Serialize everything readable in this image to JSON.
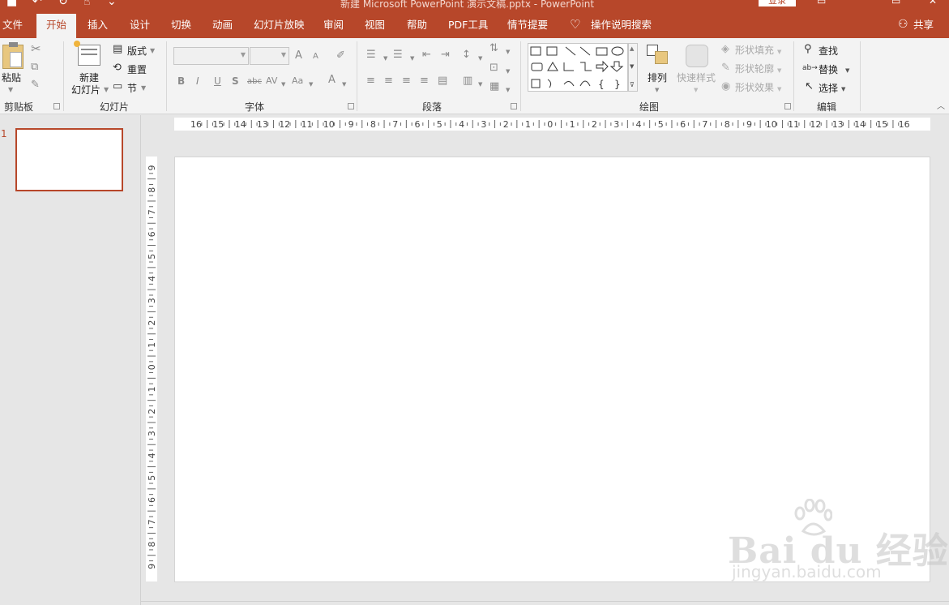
{
  "titlebar": {
    "title": "新建 Microsoft PowerPoint 演示文稿.pptx - PowerPoint",
    "login": "登录",
    "quick_access_icons": [
      "save-icon",
      "undo-icon",
      "redo-icon",
      "touch-mode-icon",
      "customize-icon"
    ]
  },
  "tabs": [
    {
      "label": "文件"
    },
    {
      "label": "开始"
    },
    {
      "label": "插入"
    },
    {
      "label": "设计"
    },
    {
      "label": "切换"
    },
    {
      "label": "动画"
    },
    {
      "label": "幻灯片放映"
    },
    {
      "label": "审阅"
    },
    {
      "label": "视图"
    },
    {
      "label": "帮助"
    },
    {
      "label": "PDF工具"
    },
    {
      "label": "情节提要"
    }
  ],
  "active_tab": "开始",
  "tell_me": "操作说明搜索",
  "share": "共享",
  "ribbon": {
    "clipboard": {
      "paste": "粘贴",
      "label": "剪贴板"
    },
    "slides": {
      "new_slide_line1": "新建",
      "new_slide_line2": "幻灯片",
      "layout": "版式",
      "reset": "重置",
      "section": "节",
      "label": "幻灯片"
    },
    "font": {
      "label": "字体",
      "bold": "B",
      "italic": "I",
      "underline": "U",
      "shadow": "S",
      "strike": "abc",
      "spacing": "AV",
      "case": "Aa",
      "color": "A",
      "grow": "A",
      "shrink": "A"
    },
    "paragraph": {
      "label": "段落"
    },
    "drawing": {
      "arrange": "排列",
      "quick_styles": "快速样式",
      "fill": "形状填充",
      "outline": "形状轮廓",
      "effects": "形状效果",
      "label": "绘图"
    },
    "editing": {
      "find": "查找",
      "replace": "替换",
      "select": "选择",
      "label": "编辑"
    }
  },
  "slides_panel": {
    "slide_number": "1"
  },
  "rulers": {
    "horizontal_labels": [
      "16",
      "15",
      "14",
      "13",
      "12",
      "11",
      "10",
      "9",
      "8",
      "7",
      "6",
      "5",
      "4",
      "3",
      "2",
      "1",
      "0",
      "1",
      "2",
      "3",
      "4",
      "5",
      "6",
      "7",
      "8",
      "9",
      "10",
      "11",
      "12",
      "13",
      "14",
      "15",
      "16"
    ],
    "vertical_labels": [
      "9",
      "8",
      "7",
      "6",
      "5",
      "4",
      "3",
      "2",
      "1",
      "0",
      "1",
      "2",
      "3",
      "4",
      "5",
      "6",
      "7",
      "8",
      "9"
    ]
  },
  "watermark": {
    "main": "Bai du 经验",
    "sub": "jingyan.baidu.com"
  },
  "colors": {
    "accent": "#b7472a",
    "ribbon": "#f3f3f3",
    "workspace": "#e6e6e6"
  }
}
